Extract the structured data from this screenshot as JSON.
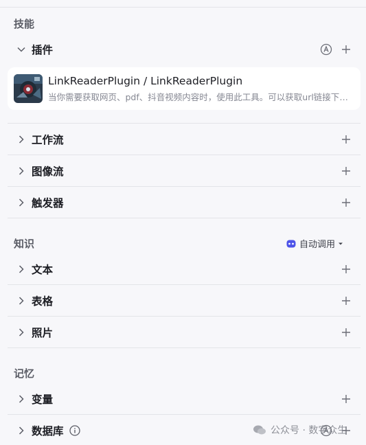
{
  "sections": {
    "skills": "技能",
    "knowledge": "知识",
    "memory": "记忆"
  },
  "plugins": {
    "label": "插件",
    "card": {
      "title": "LinkReaderPlugin / LinkReaderPlugin",
      "description": "当你需要获取网页、pdf、抖音视频内容时，使用此工具。可以获取url链接下的标题和内容。"
    }
  },
  "skills_rows": [
    "工作流",
    "图像流",
    "触发器"
  ],
  "knowledge_rows": [
    "文本",
    "表格",
    "照片"
  ],
  "memory_rows": [
    "变量",
    "数据库"
  ],
  "auto_call": "自动调用",
  "watermark": "公众号 · 数字众生",
  "icons": {
    "expand": "chevron-right-icon",
    "collapse": "chevron-down-icon",
    "add": "plus-icon",
    "auto": "circle-a-icon",
    "info": "info-icon",
    "robot": "robot-icon",
    "caret": "caret-down-icon"
  },
  "colors": {
    "background": "#f7f7fa",
    "card": "#ffffff",
    "divider": "#e3e4e8",
    "accent": "#4d53e8"
  }
}
